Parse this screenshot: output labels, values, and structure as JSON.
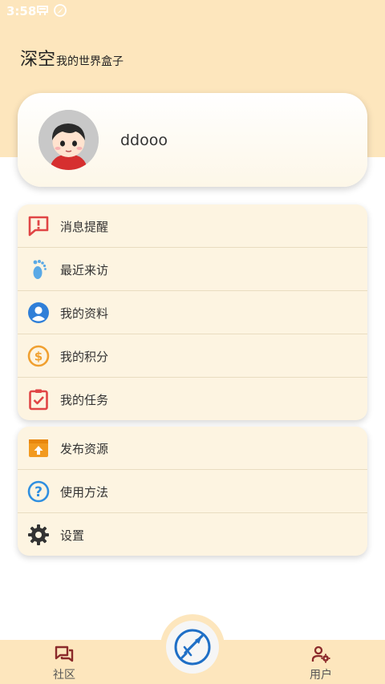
{
  "status_bar": {
    "time": "3:58"
  },
  "header": {
    "app_name": "深空",
    "subtitle": "我的世界盒子"
  },
  "profile": {
    "username": "ddooo"
  },
  "menu_group_1": [
    {
      "label": "消息提醒",
      "icon": "message-alert-icon"
    },
    {
      "label": "最近来访",
      "icon": "footprint-icon"
    },
    {
      "label": "我的资料",
      "icon": "account-icon"
    },
    {
      "label": "我的积分",
      "icon": "coin-icon"
    },
    {
      "label": "我的任务",
      "icon": "task-clipboard-icon"
    }
  ],
  "menu_group_2": [
    {
      "label": "发布资源",
      "icon": "upload-box-icon"
    },
    {
      "label": "使用方法",
      "icon": "help-icon"
    },
    {
      "label": "设置",
      "icon": "gear-icon"
    }
  ],
  "bottom_nav": {
    "community_label": "社区",
    "user_label": "用户"
  },
  "colors": {
    "header_bg": "#fde6bd",
    "card_bg": "#fdf4e1",
    "nav_icon": "#8b2a2a",
    "accent_blue": "#1f6fc6"
  }
}
